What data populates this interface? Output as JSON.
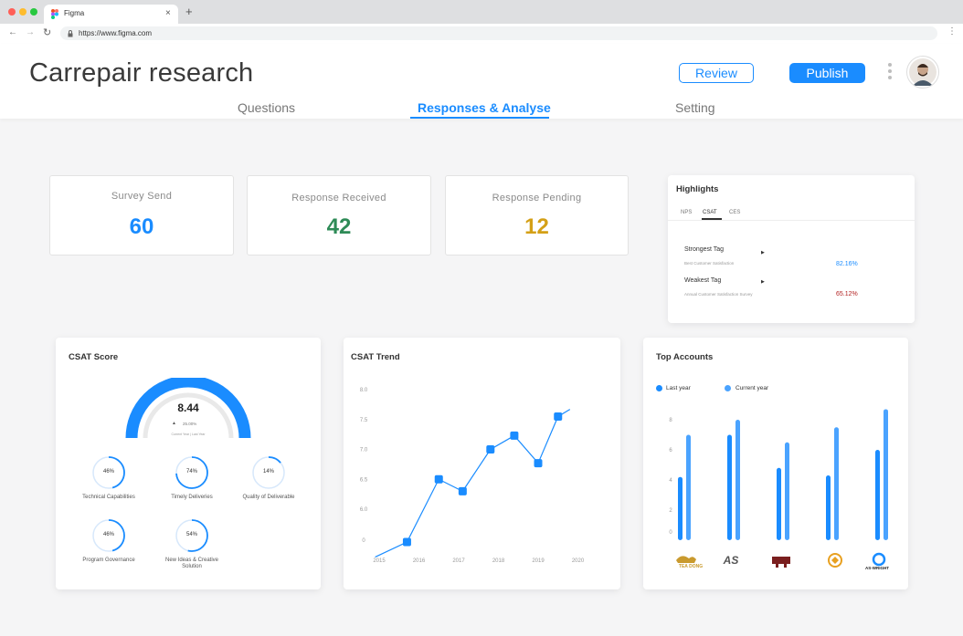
{
  "browser": {
    "tab_title": "Figma",
    "tab_close": "×",
    "new_tab": "+",
    "url": "https://www.figma.com"
  },
  "header": {
    "title": "Carrepair research",
    "review_label": "Review",
    "publish_label": "Publish",
    "tabs": [
      {
        "label": "Questions",
        "active": false
      },
      {
        "label": "Responses & Analyse",
        "active": true
      },
      {
        "label": "Setting",
        "active": false
      }
    ]
  },
  "stats": [
    {
      "label": "Survey Send",
      "value": "60",
      "color": "#1a8cff"
    },
    {
      "label": "Response Received",
      "value": "42",
      "color": "#2e8b57"
    },
    {
      "label": "Response Pending",
      "value": "12",
      "color": "#d4a017"
    }
  ],
  "highlights": {
    "title": "Highlights",
    "tabs": [
      "NPS",
      "CSAT",
      "CES"
    ],
    "active_tab": "CSAT",
    "rows": [
      {
        "label": "Strongest Tag",
        "sub": "Best Customer Satisfaction",
        "value": "82.16%",
        "value_color": "#1a8cff"
      },
      {
        "label": "Weakest Tag",
        "sub": "Annual Customer Satisfaction Survey",
        "value": "65.12%",
        "value_color": "#b22222"
      }
    ]
  },
  "csat_score": {
    "title": "CSAT Score",
    "score": "8.44",
    "change": "25.00%",
    "gauge_caption": "Current Year | Last Year",
    "circles": [
      {
        "value": "46%",
        "label": "Technical Capabilities",
        "fraction": 0.46
      },
      {
        "value": "74%",
        "label": "Timely Deliveries",
        "fraction": 0.74
      },
      {
        "value": "14%",
        "label": "Quality of Deliverable",
        "fraction": 0.14
      },
      {
        "value": "46%",
        "label": "Program Governance",
        "fraction": 0.46
      },
      {
        "value": "54%",
        "label": "New Ideas & Creative Solution",
        "fraction": 0.54
      }
    ]
  },
  "chart_data": [
    {
      "type": "line",
      "title": "CSAT Trend",
      "x_ticks": [
        "2015",
        "2016",
        "2017",
        "2018",
        "2019",
        "2020"
      ],
      "y_ticks": [
        "0",
        "6.0",
        "6.5",
        "7.0",
        "7.5",
        "8.0"
      ],
      "series": [
        {
          "x": [
            2014.9,
            2015.7,
            2016.5,
            2017.1,
            2017.8,
            2018.4,
            2019.0,
            2019.5,
            2019.8
          ],
          "y": [
            5.2,
            5.45,
            6.5,
            6.3,
            7.0,
            7.23,
            6.77,
            7.55,
            7.67
          ],
          "markers": [
            false,
            true,
            true,
            true,
            true,
            true,
            true,
            true,
            false
          ]
        }
      ],
      "color": "#1a8cff"
    },
    {
      "type": "bar",
      "title": "Top Accounts",
      "legend": [
        {
          "name": "Last year",
          "color": "#1a8cff"
        },
        {
          "name": "Current year",
          "color": "#4aa3ff"
        }
      ],
      "y_ticks": [
        "0",
        "2",
        "4",
        "6",
        "8"
      ],
      "categories": [
        "TEA DONG",
        "AS",
        "",
        "",
        "AS-WRIGHT"
      ],
      "series": [
        {
          "name": "Last year",
          "values": [
            4.2,
            7.0,
            4.8,
            4.3,
            6.0
          ]
        },
        {
          "name": "Current year",
          "values": [
            7.0,
            8.0,
            6.5,
            7.5,
            8.7
          ]
        }
      ],
      "ylim": [
        0,
        9
      ],
      "logo_colors": [
        "#c99a2e",
        "#555555",
        "#7a1f1f",
        "#e8a020",
        "#1a8cff"
      ]
    }
  ]
}
